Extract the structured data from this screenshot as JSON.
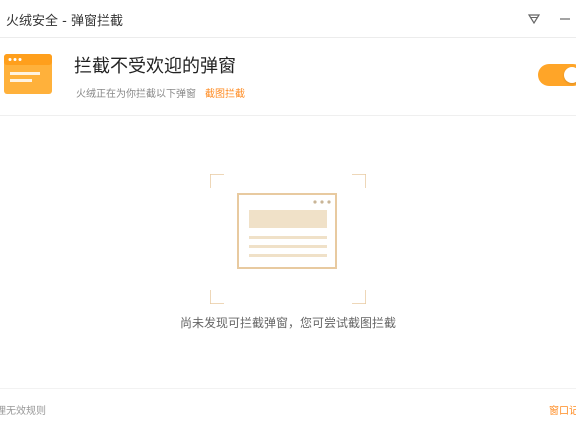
{
  "window": {
    "title": "火绒安全 - 弹窗拦截",
    "menu_icon": "diamond-menu-icon",
    "minimize_icon": "minimize-icon"
  },
  "header": {
    "title": "拦截不受欢迎的弹窗",
    "description": "火绒正在为你拦截以下弹窗",
    "screenshot_link": "截图拦截",
    "toggle_on": true,
    "accent_color": "#ffa528"
  },
  "content": {
    "empty_message": "尚未发现可拦截弹窗，您可尝试截图拦截"
  },
  "footer": {
    "left_link": "理无效规则",
    "right_link": "窗口记"
  }
}
